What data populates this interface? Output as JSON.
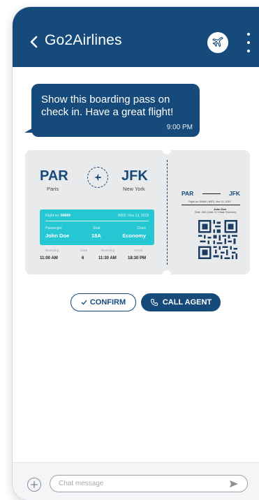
{
  "header": {
    "title": "Go2Airlines",
    "back_icon": "chevron-left-icon",
    "avatar_icon": "airplane-icon",
    "menu_icon": "kebab-menu-icon",
    "bg_color": "#154a7a"
  },
  "message": {
    "text": "Show this boarding pass on check in. Have a great flight!",
    "time": "9:00 PM"
  },
  "boarding_pass": {
    "from_code": "PAR",
    "from_city": "Paris",
    "to_code": "JFK",
    "to_city": "New York",
    "flight_label": "Flight no:",
    "flight_no": "84684",
    "date": "WED, Nov 13, 2019",
    "passenger_label": "Passenger",
    "passenger": "John Doe",
    "seat_label": "Seat",
    "seat": "18A",
    "class_label": "Class",
    "class": "Economy",
    "boarding_label": "Boarding",
    "boarding": "11:00 AM",
    "gate_label": "Gate",
    "gate": "6",
    "boarding2_label": "Boarding",
    "boarding2": "11:30 AM",
    "arrive_label": "Arrive",
    "arrive": "18:30 PM",
    "accent_color": "#25c7d3",
    "stub": {
      "from_code": "PAR",
      "to_code": "JFK",
      "flight_line": "Flight no: 84684  |  WED, Nov 13, 2019",
      "name": "John Doe",
      "detail_line": "Seat: 18A  |  Gate: 6  |  Class: Economy"
    }
  },
  "actions": {
    "confirm_label": "CONFIRM",
    "call_label": "CALL AGENT"
  },
  "composer": {
    "placeholder": "Chat message"
  }
}
